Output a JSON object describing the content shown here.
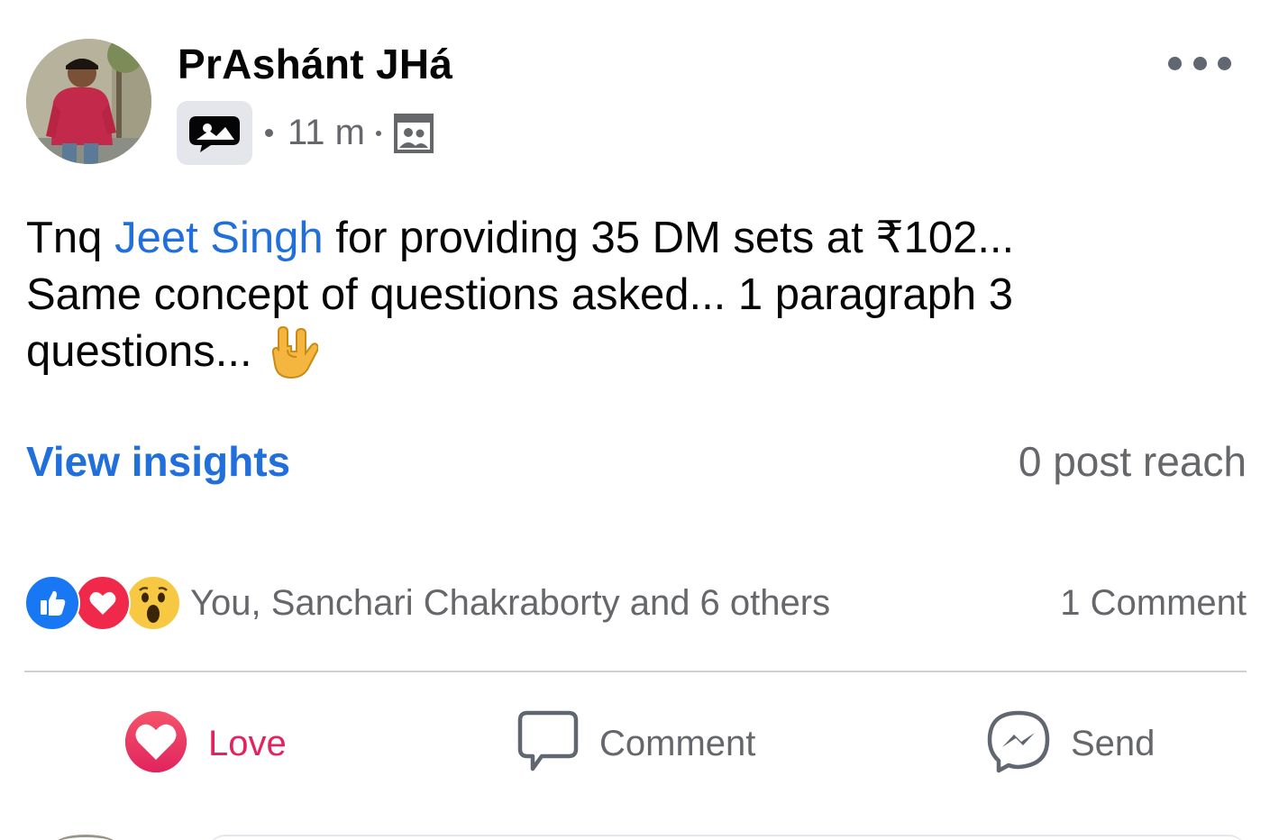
{
  "author": {
    "name": "PrAshánt JHá"
  },
  "meta": {
    "time": "11 m",
    "sticker_icon": "sticker-bubble-icon",
    "audience_icon": "friends-group-icon"
  },
  "post": {
    "text_prefix": "Tnq ",
    "mention": "Jeet Singh",
    "text_line1_rest": " for providing 35 DM sets at ₹102...",
    "text_line2": "Same concept of questions asked... 1 paragraph 3",
    "text_line3": "questions...",
    "emoji": "love-you-gesture-icon"
  },
  "insights": {
    "view_label": "View insights",
    "reach_text": "0 post reach"
  },
  "reactions": {
    "icons": [
      "like-reaction-icon",
      "love-reaction-icon",
      "wow-reaction-icon"
    ],
    "names_text": "You, Sanchari Chakraborty and 6 others",
    "comments_text": "1 Comment"
  },
  "actions": {
    "love_label": "Love",
    "comment_label": "Comment",
    "send_label": "Send"
  },
  "colors": {
    "link_blue": "#216fdb",
    "love_red": "#e0245e",
    "secondary_text": "#65676b",
    "like_blue": "#1877f2",
    "wow_yellow": "#f7c943"
  }
}
